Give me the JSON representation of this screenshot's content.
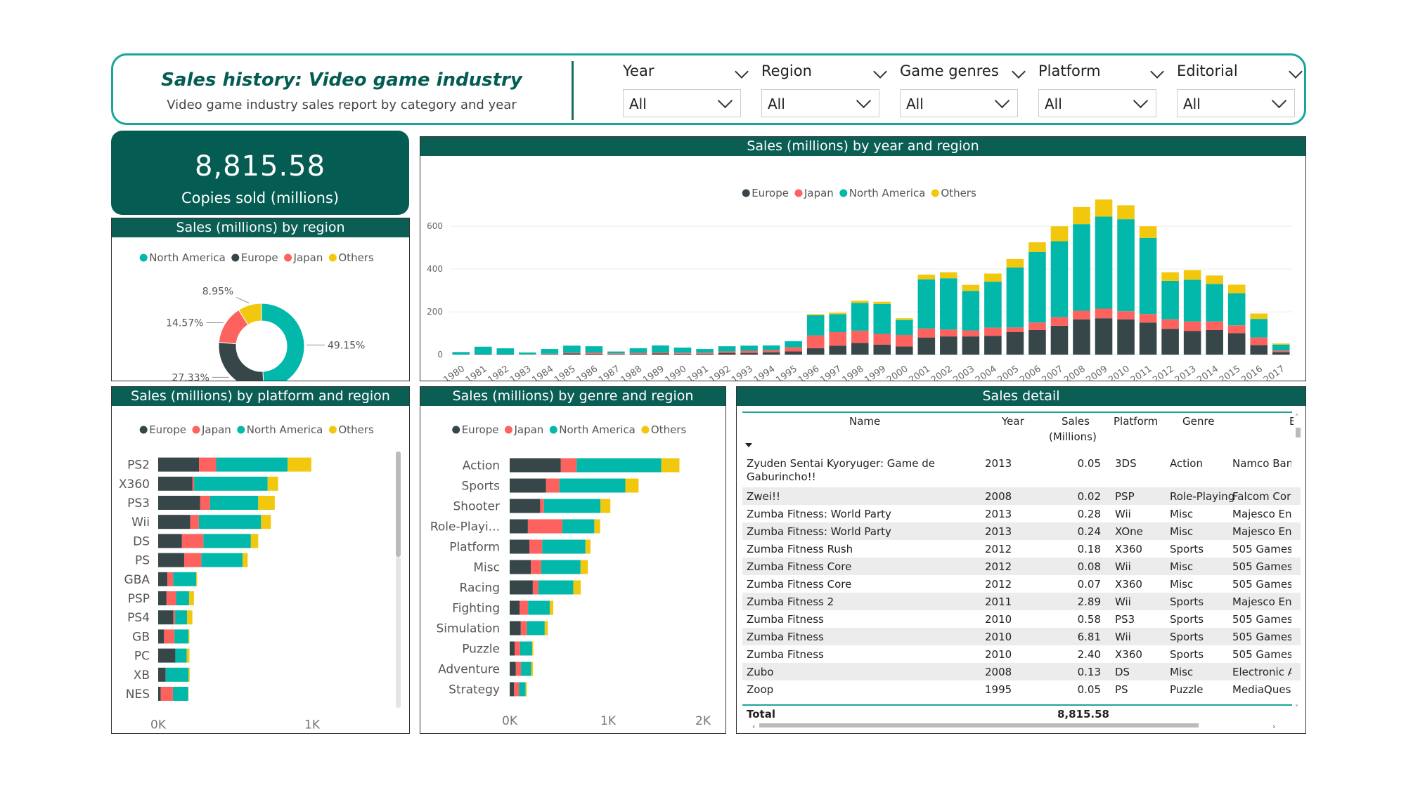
{
  "header": {
    "title": "Sales history: Video game industry",
    "subtitle": "Video game industry sales report by category and year"
  },
  "filters": [
    {
      "label": "Year",
      "value": "All"
    },
    {
      "label": "Region",
      "value": "All"
    },
    {
      "label": "Game genres",
      "value": "All"
    },
    {
      "label": "Platform",
      "value": "All"
    },
    {
      "label": "Editorial",
      "value": "All"
    }
  ],
  "kpi": {
    "value": "8,815.58",
    "label": "Copies sold (millions)"
  },
  "colors": {
    "Europe": "#374649",
    "Japan": "#fd625e",
    "North America": "#01b8aa",
    "Others": "#f2c80f",
    "header_teal": "#045c52"
  },
  "panels": {
    "region_title": "Sales (millions) by region",
    "year_title": "Sales (millions) by year and region",
    "platform_title": "Sales (millions) by platform and region",
    "genre_title": "Sales (millions) by genre and region",
    "detail_title": "Sales detail"
  },
  "chart_data": [
    {
      "id": "region",
      "type": "pie",
      "title": "Sales (millions) by region",
      "legend": [
        "North America",
        "Europe",
        "Japan",
        "Others"
      ],
      "legend_position": "top",
      "slices": [
        {
          "name": "North America",
          "value": 49.15,
          "label": "49.15%"
        },
        {
          "name": "Europe",
          "value": 27.33,
          "label": "27.33%"
        },
        {
          "name": "Japan",
          "value": 14.57,
          "label": "14.57%"
        },
        {
          "name": "Others",
          "value": 8.95,
          "label": "8.95%"
        }
      ]
    },
    {
      "id": "year",
      "type": "bar",
      "stacked": true,
      "title": "Sales (millions) by year and region",
      "legend": [
        "Europe",
        "Japan",
        "North America",
        "Others"
      ],
      "legend_position": "top",
      "categories": [
        "1980",
        "1981",
        "1982",
        "1983",
        "1984",
        "1985",
        "1986",
        "1987",
        "1988",
        "1989",
        "1990",
        "1991",
        "1992",
        "1993",
        "1994",
        "1995",
        "1996",
        "1997",
        "1998",
        "1999",
        "2000",
        "2001",
        "2002",
        "2003",
        "2004",
        "2005",
        "2006",
        "2007",
        "2008",
        "2009",
        "2010",
        "2011",
        "2012",
        "2013",
        "2014",
        "2015",
        "2016",
        "2017"
      ],
      "yticks": [
        0,
        200,
        400,
        600
      ],
      "ylim": [
        0,
        700
      ],
      "grid": true,
      "series": [
        {
          "name": "Europe",
          "values": [
            1,
            2,
            1.5,
            1,
            2,
            5,
            4,
            1.5,
            3,
            5,
            4,
            4,
            8,
            8,
            11,
            15,
            30,
            42,
            55,
            47,
            38,
            80,
            85,
            85,
            88,
            105,
            115,
            135,
            165,
            170,
            165,
            150,
            120,
            110,
            115,
            100,
            45,
            12
          ]
        },
        {
          "name": "Japan",
          "values": [
            0,
            0,
            0,
            1,
            2,
            4,
            6,
            4,
            5,
            5,
            5,
            5,
            7,
            10,
            10,
            19,
            60,
            63,
            57,
            50,
            54,
            42,
            32,
            28,
            38,
            22,
            35,
            40,
            40,
            45,
            38,
            40,
            45,
            45,
            40,
            37,
            35,
            7
          ]
        },
        {
          "name": "North America",
          "values": [
            11,
            35,
            28,
            8,
            22,
            33,
            29,
            9,
            22,
            33,
            24,
            17,
            24,
            24,
            22,
            29,
            94,
            84,
            130,
            140,
            70,
            230,
            240,
            185,
            215,
            280,
            330,
            355,
            405,
            430,
            430,
            355,
            180,
            195,
            175,
            150,
            87,
            28
          ]
        },
        {
          "name": "Others",
          "values": [
            0,
            0,
            0,
            0,
            0,
            0,
            0,
            0,
            0,
            0,
            0,
            0,
            0,
            0,
            0,
            0,
            5,
            7,
            10,
            10,
            8,
            22,
            28,
            28,
            38,
            40,
            45,
            70,
            80,
            80,
            65,
            55,
            40,
            45,
            40,
            40,
            25,
            5
          ]
        }
      ]
    },
    {
      "id": "platform",
      "type": "bar",
      "orientation": "horizontal",
      "stacked": true,
      "title": "Sales (millions) by platform and region",
      "legend": [
        "Europe",
        "Japan",
        "North America",
        "Others"
      ],
      "legend_position": "top",
      "categories": [
        "PS2",
        "X360",
        "PS3",
        "Wii",
        "DS",
        "PS",
        "GBA",
        "PSP",
        "PS4",
        "GB",
        "PC",
        "XB",
        "NES"
      ],
      "xticks": [
        "0K",
        "1K"
      ],
      "xlim": [
        0,
        1250
      ],
      "series": [
        {
          "name": "Europe",
          "values": [
            333,
            280,
            343,
            262,
            194,
            212,
            75,
            68,
            123,
            48,
            140,
            61,
            21
          ]
        },
        {
          "name": "Japan",
          "values": [
            140,
            13,
            80,
            70,
            175,
            140,
            47,
            78,
            15,
            85,
            0,
            1,
            99
          ]
        },
        {
          "name": "North America",
          "values": [
            583,
            600,
            393,
            507,
            387,
            337,
            188,
            106,
            97,
            114,
            93,
            186,
            125
          ]
        },
        {
          "name": "Others",
          "values": [
            193,
            85,
            135,
            80,
            60,
            41,
            8,
            40,
            44,
            8,
            22,
            9,
            3
          ]
        }
      ]
    },
    {
      "id": "genre",
      "type": "bar",
      "orientation": "horizontal",
      "stacked": true,
      "title": "Sales (millions) by genre and region",
      "legend": [
        "Europe",
        "Japan",
        "North America",
        "Others"
      ],
      "legend_position": "top",
      "categories": [
        "Action",
        "Sports",
        "Shooter",
        "Role-Playi...",
        "Platform",
        "Misc",
        "Racing",
        "Fighting",
        "Simulation",
        "Puzzle",
        "Adventure",
        "Strategy"
      ],
      "xticks": [
        "0K",
        "1K",
        "2K"
      ],
      "xlim": [
        0,
        2000
      ],
      "series": [
        {
          "name": "Europe",
          "values": [
            520,
            370,
            310,
            185,
            200,
            215,
            235,
            100,
            113,
            50,
            63,
            45
          ]
        },
        {
          "name": "Japan",
          "values": [
            160,
            135,
            38,
            350,
            130,
            105,
            56,
            87,
            63,
            56,
            52,
            49
          ]
        },
        {
          "name": "North America",
          "values": [
            860,
            670,
            575,
            325,
            440,
            400,
            355,
            220,
            180,
            122,
            105,
            68
          ]
        },
        {
          "name": "Others",
          "values": [
            185,
            135,
            100,
            60,
            51,
            74,
            76,
            36,
            31,
            12,
            17,
            12
          ]
        }
      ]
    }
  ],
  "table": {
    "headers": {
      "name": "Name",
      "year": "Year",
      "sales1": "Sales",
      "sales2": "(Millions)",
      "platform": "Platform",
      "genre": "Genre",
      "editorial": "E"
    },
    "rows": [
      {
        "name": "Zyuden Sentai Kyoryuger: Game de",
        "name2": "Gaburincho!!",
        "year": "2013",
        "sales": "0.05",
        "platform": "3DS",
        "genre": "Action",
        "editorial": "Namco Ban"
      },
      {
        "name": "Zwei!!",
        "year": "2008",
        "sales": "0.02",
        "platform": "PSP",
        "genre": "Role-Playing",
        "editorial": "Falcom Cor"
      },
      {
        "name": "Zumba Fitness: World Party",
        "year": "2013",
        "sales": "0.28",
        "platform": "Wii",
        "genre": "Misc",
        "editorial": "Majesco En"
      },
      {
        "name": "Zumba Fitness: World Party",
        "year": "2013",
        "sales": "0.24",
        "platform": "XOne",
        "genre": "Misc",
        "editorial": "Majesco En"
      },
      {
        "name": "Zumba Fitness Rush",
        "year": "2012",
        "sales": "0.18",
        "platform": "X360",
        "genre": "Sports",
        "editorial": "505 Games"
      },
      {
        "name": "Zumba Fitness Core",
        "year": "2012",
        "sales": "0.08",
        "platform": "Wii",
        "genre": "Misc",
        "editorial": "505 Games"
      },
      {
        "name": "Zumba Fitness Core",
        "year": "2012",
        "sales": "0.07",
        "platform": "X360",
        "genre": "Misc",
        "editorial": "505 Games"
      },
      {
        "name": "Zumba Fitness 2",
        "year": "2011",
        "sales": "2.89",
        "platform": "Wii",
        "genre": "Sports",
        "editorial": "Majesco En"
      },
      {
        "name": "Zumba Fitness",
        "year": "2010",
        "sales": "0.58",
        "platform": "PS3",
        "genre": "Sports",
        "editorial": "505 Games"
      },
      {
        "name": "Zumba Fitness",
        "year": "2010",
        "sales": "6.81",
        "platform": "Wii",
        "genre": "Sports",
        "editorial": "505 Games"
      },
      {
        "name": "Zumba Fitness",
        "year": "2010",
        "sales": "2.40",
        "platform": "X360",
        "genre": "Sports",
        "editorial": "505 Games"
      },
      {
        "name": "Zubo",
        "year": "2008",
        "sales": "0.13",
        "platform": "DS",
        "genre": "Misc",
        "editorial": "Electronic A"
      },
      {
        "name": "Zoop",
        "year": "1995",
        "sales": "0.05",
        "platform": "PS",
        "genre": "Puzzle",
        "editorial": "MediaQues"
      }
    ],
    "total_label": "Total",
    "total_value": "8,815.58"
  }
}
